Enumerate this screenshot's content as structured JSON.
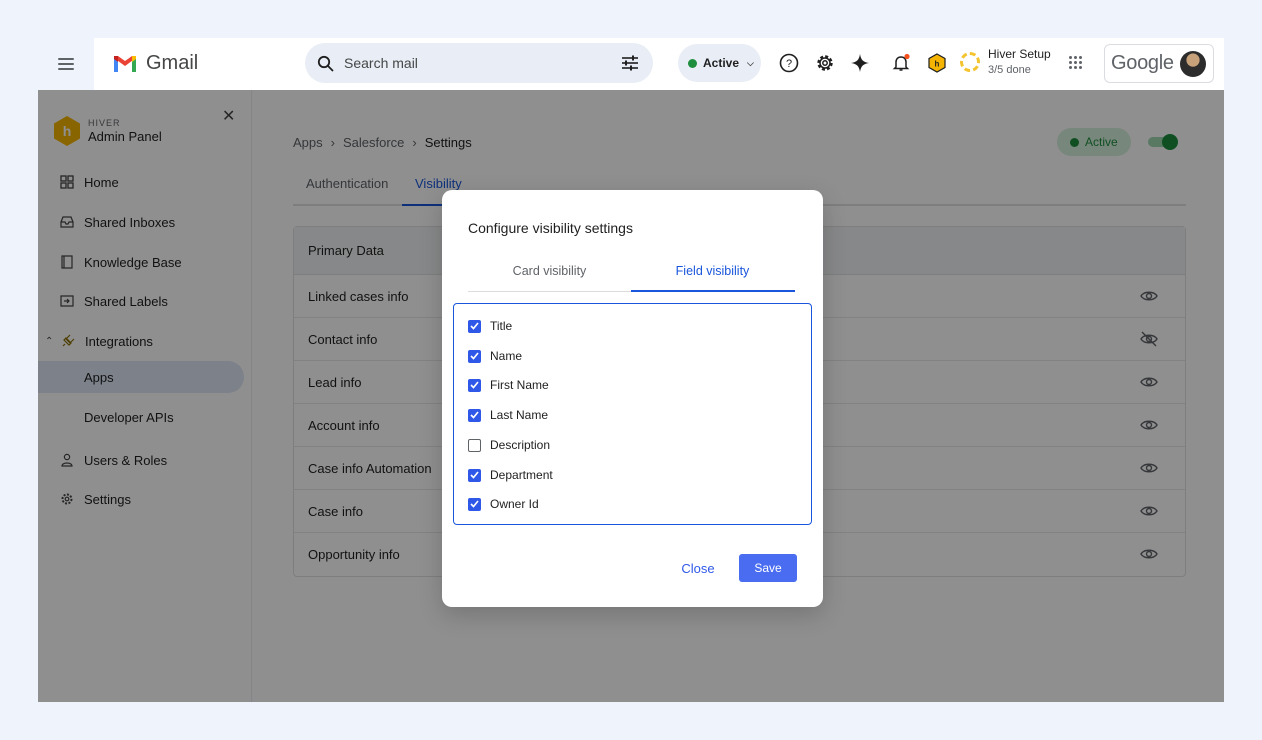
{
  "gmail": {
    "brand": "Gmail",
    "search_placeholder": "Search mail",
    "status_label": "Active",
    "setup_title": "Hiver Setup",
    "setup_progress": "3/5 done",
    "account_brand": "Google"
  },
  "sidebar": {
    "brand_small": "HIVER",
    "brand_big": "Admin Panel",
    "items": [
      {
        "label": "Home",
        "icon": "grid-icon"
      },
      {
        "label": "Shared Inboxes",
        "icon": "inbox-icon"
      },
      {
        "label": "Knowledge Base",
        "icon": "book-icon"
      },
      {
        "label": "Shared Labels",
        "icon": "label-icon"
      },
      {
        "label": "Integrations",
        "icon": "plug-icon"
      },
      {
        "label": "Apps",
        "icon": ""
      },
      {
        "label": "Developer APIs",
        "icon": ""
      },
      {
        "label": "Users & Roles",
        "icon": "user-icon"
      },
      {
        "label": "Settings",
        "icon": "gear-icon"
      }
    ]
  },
  "breadcrumb": [
    "Apps",
    "Salesforce",
    "Settings"
  ],
  "status_pill": "Active",
  "tabs": [
    "Authentication",
    "Visibility"
  ],
  "table": {
    "header": "Primary Data",
    "rows": [
      {
        "label": "Linked cases info",
        "visible": true
      },
      {
        "label": "Contact info",
        "visible": false
      },
      {
        "label": "Lead info",
        "visible": true
      },
      {
        "label": "Account info",
        "visible": true
      },
      {
        "label": "Case info Automation",
        "visible": true
      },
      {
        "label": "Case info",
        "visible": true
      },
      {
        "label": "Opportunity info",
        "visible": true
      }
    ]
  },
  "modal": {
    "title": "Configure visibility settings",
    "tabs": [
      "Card visibility",
      "Field visibility"
    ],
    "selected_tab": "Field visibility",
    "fields": [
      {
        "label": "Title",
        "checked": true
      },
      {
        "label": "Name",
        "checked": true
      },
      {
        "label": "First Name",
        "checked": true
      },
      {
        "label": "Last Name",
        "checked": true
      },
      {
        "label": "Description",
        "checked": false
      },
      {
        "label": "Department",
        "checked": true
      },
      {
        "label": "Owner Id",
        "checked": true
      }
    ],
    "close_label": "Close",
    "save_label": "Save"
  },
  "colors": {
    "accent": "#1a56db",
    "primary_button": "#4a6cf0",
    "active_green": "#1e8e3e",
    "hiver_yellow": "#f5b400"
  }
}
